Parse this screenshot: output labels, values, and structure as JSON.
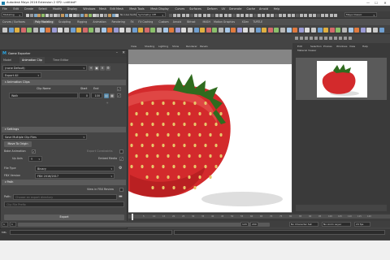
{
  "window": {
    "title": "Autodesk Maya 2016 Extension 2 SP2: untitled*",
    "min": "—",
    "max": "☐",
    "close": "✕"
  },
  "menus": [
    "File",
    "Edit",
    "Create",
    "Select",
    "Modify",
    "Display",
    "Windows",
    "Mesh",
    "Edit Mesh",
    "Mesh Tools",
    "Mesh Display",
    "Curves",
    "Surfaces",
    "Deform",
    "UV",
    "Generate",
    "Cache",
    "Arnold",
    "Help"
  ],
  "statusline": {
    "mode": "Modeling",
    "no_live": "No Live Surface",
    "symmetry": "Symmetry: Off",
    "workspace": "Maya Classic"
  },
  "shelf_tabs": [
    "Curves / Surfaces",
    "Poly Modeling",
    "Sculpting",
    "Rigging",
    "Animation",
    "Rendering",
    "FX",
    "FX Caching",
    "Custom",
    "Arnold",
    "Bifrost",
    "MASH",
    "Motion Graphics",
    "XGen",
    "TURTLE"
  ],
  "active_shelf_tab": "Poly Modeling",
  "game_exporter": {
    "title": "Game Exporter",
    "tabs": [
      "Model",
      "Animation Clip",
      "Time Editor"
    ],
    "active_tab": "Animation Clip",
    "preset": "(none Default)",
    "export_mode": "Export All",
    "clips_section": "Animation Clips",
    "clip_headers": {
      "name": "Clip Name",
      "start": "Start",
      "end": "End"
    },
    "clips": [
      {
        "name": "Walk",
        "start": "0",
        "end": "100"
      }
    ],
    "settings_section": "Settings",
    "save_multiple": "Save Multiple Clip Files",
    "move_origin": "Move To Origin",
    "bake_animation": "Bake Animation",
    "bake_checked": true,
    "bake_label_right": "Export Constraints",
    "up_axis_label": "Up Axis",
    "up_axis": "Y",
    "embed_media": "Embed Media",
    "embed_checked": true,
    "file_type_label": "File Type",
    "file_type": "Binary",
    "fbx_version_label": "FBX Version",
    "fbx_version": "FBX 2016/2017",
    "path_section": "Path",
    "view_in_fbx": "View in FBX Review",
    "path_label": "Path:",
    "path_placeholder": "Choose an export directory",
    "prefix_placeholder": "Clip File Prefix",
    "export_button": "Export"
  },
  "viewport": {
    "menu": [
      "View",
      "Shading",
      "Lighting",
      "Show",
      "Renderer",
      "Panels"
    ],
    "caption": "persp"
  },
  "right_panel": {
    "menu": [
      "Edit",
      "Selection",
      "Proxies",
      "Windows",
      "View",
      "Help"
    ],
    "subhead": "Material Viewer"
  },
  "timeline": {
    "ticks": [
      "5",
      "10",
      "15",
      "20",
      "25",
      "30",
      "35",
      "40",
      "45",
      "50",
      "55",
      "60",
      "65",
      "70",
      "75",
      "80",
      "85",
      "90",
      "95",
      "100",
      "105",
      "110",
      "115",
      "120"
    ],
    "start": "1",
    "end": "120",
    "range_start": "1",
    "range_end": "200",
    "current": "1",
    "no_char": "No Character Set",
    "no_anim": "No Anim Layer",
    "fps": "24 fps"
  },
  "cmdline": {
    "lang": "MEL"
  },
  "colors": {
    "accent": "#1c7ea8",
    "strawberry": "#d0262a",
    "leaf": "#2f6b1e"
  }
}
